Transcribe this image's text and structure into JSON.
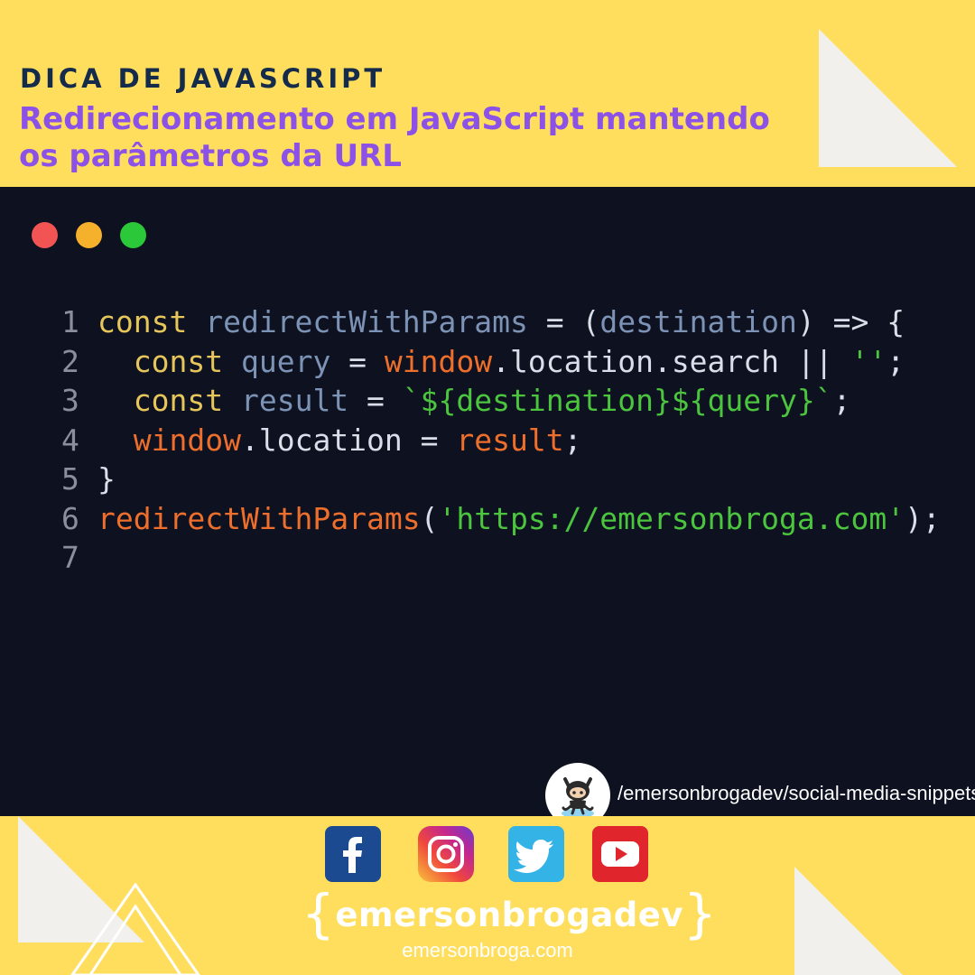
{
  "header": {
    "kicker": "DICA DE JAVASCRIPT",
    "title": "Redirecionamento em JavaScript mantendo os parâmetros da URL"
  },
  "window_controls": [
    "close",
    "minimize",
    "maximize"
  ],
  "code": {
    "lines": [
      {
        "number": "1",
        "tokens": [
          {
            "text": "const",
            "kind": "keyword"
          },
          {
            "text": " ",
            "kind": "plain"
          },
          {
            "text": "redirectWithParams",
            "kind": "ident"
          },
          {
            "text": " = (",
            "kind": "plain"
          },
          {
            "text": "destination",
            "kind": "ident"
          },
          {
            "text": ") => {",
            "kind": "plain"
          }
        ]
      },
      {
        "number": "2",
        "tokens": [
          {
            "text": "  ",
            "kind": "plain"
          },
          {
            "text": "const",
            "kind": "keyword"
          },
          {
            "text": " ",
            "kind": "plain"
          },
          {
            "text": "query",
            "kind": "ident"
          },
          {
            "text": " = ",
            "kind": "plain"
          },
          {
            "text": "window",
            "kind": "builtin"
          },
          {
            "text": ".location.search || ",
            "kind": "plain"
          },
          {
            "text": "''",
            "kind": "string"
          },
          {
            "text": ";",
            "kind": "plain"
          }
        ]
      },
      {
        "number": "3",
        "tokens": [
          {
            "text": "  ",
            "kind": "plain"
          },
          {
            "text": "const",
            "kind": "keyword"
          },
          {
            "text": " ",
            "kind": "plain"
          },
          {
            "text": "result",
            "kind": "ident"
          },
          {
            "text": " = ",
            "kind": "plain"
          },
          {
            "text": "`${destination}${query}`",
            "kind": "string"
          },
          {
            "text": ";",
            "kind": "plain"
          }
        ]
      },
      {
        "number": "4",
        "tokens": [
          {
            "text": "  ",
            "kind": "plain"
          },
          {
            "text": "window",
            "kind": "builtin"
          },
          {
            "text": ".location = ",
            "kind": "plain"
          },
          {
            "text": "result",
            "kind": "builtin"
          },
          {
            "text": ";",
            "kind": "plain"
          }
        ]
      },
      {
        "number": "5",
        "tokens": [
          {
            "text": "}",
            "kind": "plain"
          }
        ]
      },
      {
        "number": "6",
        "tokens": [
          {
            "text": "redirectWithParams",
            "kind": "builtin"
          },
          {
            "text": "(",
            "kind": "plain"
          },
          {
            "text": "'https://emersonbroga.com'",
            "kind": "string"
          },
          {
            "text": ");",
            "kind": "plain"
          }
        ]
      },
      {
        "number": "7",
        "tokens": []
      }
    ]
  },
  "github": {
    "icon": "github-octocat-icon",
    "link_text": "/emersonbrogadev/social-media-snippets"
  },
  "social": [
    {
      "name": "facebook",
      "icon": "facebook-icon",
      "color": "#1B4A91"
    },
    {
      "name": "instagram",
      "icon": "instagram-icon",
      "color": "#C3278E"
    },
    {
      "name": "twitter",
      "icon": "twitter-icon",
      "color": "#33B3E6"
    },
    {
      "name": "youtube",
      "icon": "youtube-icon",
      "color": "#E0252C"
    }
  ],
  "brand": {
    "open_brace": "{",
    "name": "emersonbrogadev",
    "close_brace": "}",
    "site": "emersonbroga.com"
  },
  "colors": {
    "background": "#FEDE5C",
    "code_background": "#0D1120",
    "kicker": "#152B4C",
    "title": "#8C52E8"
  }
}
